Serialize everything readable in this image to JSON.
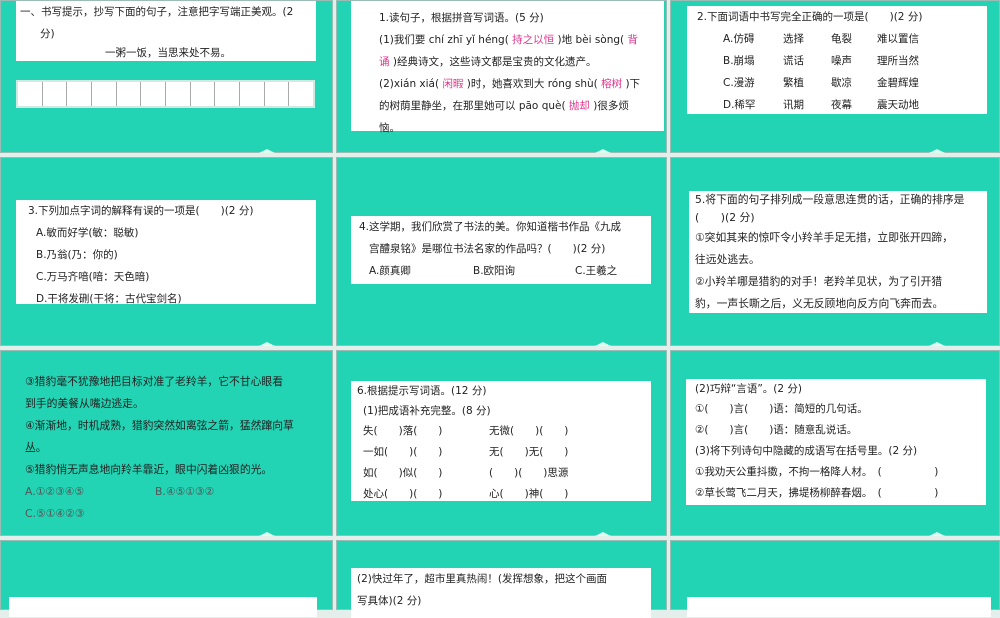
{
  "s1": {
    "title": "一、书写提示，抄写下面的句子，注意把字写端正美观。(2",
    "title2": "分)",
    "sentence": "一粥一饭，当思来处不易。"
  },
  "s2": {
    "q": "1.读句子，根据拼音写词语。(5 分)",
    "l1a": "(1)我们要 chí zhī yǐ héng(",
    "a1": "持之以恒",
    "l1b": ")地 bèi sòng(",
    "a2": "背",
    "a2b": "诵",
    "l2": ")经典诗文，这些诗文都是宝贵的文化遗产。",
    "l3a": "(2)xián xiá(",
    "a3": "闲暇",
    "l3b": ")时，她喜欢到大 róng shù(",
    "a4": "榕树",
    "l3c": ")下",
    "l4a": "的树荫里静坐，在那里她可以 pāo què(",
    "a5": "抛却",
    "l4b": ")很多烦",
    "l5": "恼。"
  },
  "s3": {
    "q": "2.下面词语中书写完全正确的一项是(　　)(2 分)",
    "rows": [
      [
        "A.仿碍",
        "选择",
        "龟裂",
        "难以置信"
      ],
      [
        "B.崩塌",
        "谎话",
        "噪声",
        "理所当然"
      ],
      [
        "C.漫游",
        "繁植",
        "歇凉",
        "金碧辉煌"
      ],
      [
        "D.稀罕",
        "讯期",
        "夜幕",
        "震天动地"
      ]
    ]
  },
  "s4": {
    "q": "3.下列加点字词的解释有误的一项是(　　)(2 分)",
    "opts": [
      "A.敏而好学(敏：聪敏)",
      "B.乃翁(乃：你的)",
      "C.万马齐喑(喑：天色暗)",
      "D.干将发硎(干将：古代宝剑名)"
    ]
  },
  "s5": {
    "q1": "4.这学期，我们欣赏了书法的美。你知道楷书作品《九成",
    "q2": "宫醴泉铭》是哪位书法名家的作品吗？(　　)(2 分)",
    "opts": [
      "A.颜真卿",
      "B.欧阳询",
      "C.王羲之"
    ]
  },
  "s6": {
    "lines": [
      "5.将下面的句子排列成一段意思连贯的话，正确的排序是",
      "(　　)(2 分)",
      "①突如其来的惊吓令小羚羊手足无措，立即张开四蹄，",
      "往远处逃去。",
      "②小羚羊哪是猎豹的对手！老羚羊见状，为了引开猎",
      "豹，一声长嘶之后，义无反顾地向反方向飞奔而去。"
    ]
  },
  "s7": {
    "lines": [
      "③猎豹毫不犹豫地把目标对准了老羚羊，它不甘心眼看",
      "到手的美餐从嘴边逃走。",
      "④渐渐地，时机成熟，猎豹突然如离弦之箭，猛然蹿向草",
      "丛。",
      "⑤猎豹悄无声息地向羚羊靠近，眼中闪着凶狠的光。"
    ],
    "optA": "A.①②③④⑤",
    "optB": "B.④⑤①③②",
    "optC": "C.⑤①④②③"
  },
  "s8": {
    "q": "6.根据提示写词语。(12 分)",
    "sub": "(1)把成语补充完整。(8 分)",
    "rows": [
      [
        "失(　　)落(　　)",
        "无微(　　)(　　)"
      ],
      [
        "一如(　　)(　　)",
        "无(　　)无(　　)"
      ],
      [
        "如(　　)似(　　)",
        "(　　)(　　)思源"
      ],
      [
        "处心(　　)(　　)",
        "心(　　)神(　　)"
      ]
    ]
  },
  "s9": {
    "lines": [
      "(2)巧辩“言语”。(2 分)",
      "①(　　)言(　　)语：简短的几句话。",
      "②(　　)言(　　)语：随意乱说话。",
      "(3)将下列诗句中隐藏的成语写在括号里。(2 分)",
      "①我劝天公重抖擞，不拘一格降人材。　(　　　　　)",
      "②草长莺飞二月天，拂堤杨柳醉春烟。　(　　　　　)"
    ]
  },
  "s11": {
    "l1": "(2)快过年了，超市里真热闹！(发挥想象，把这个画面",
    "l2": "写具体)(2 分)"
  }
}
